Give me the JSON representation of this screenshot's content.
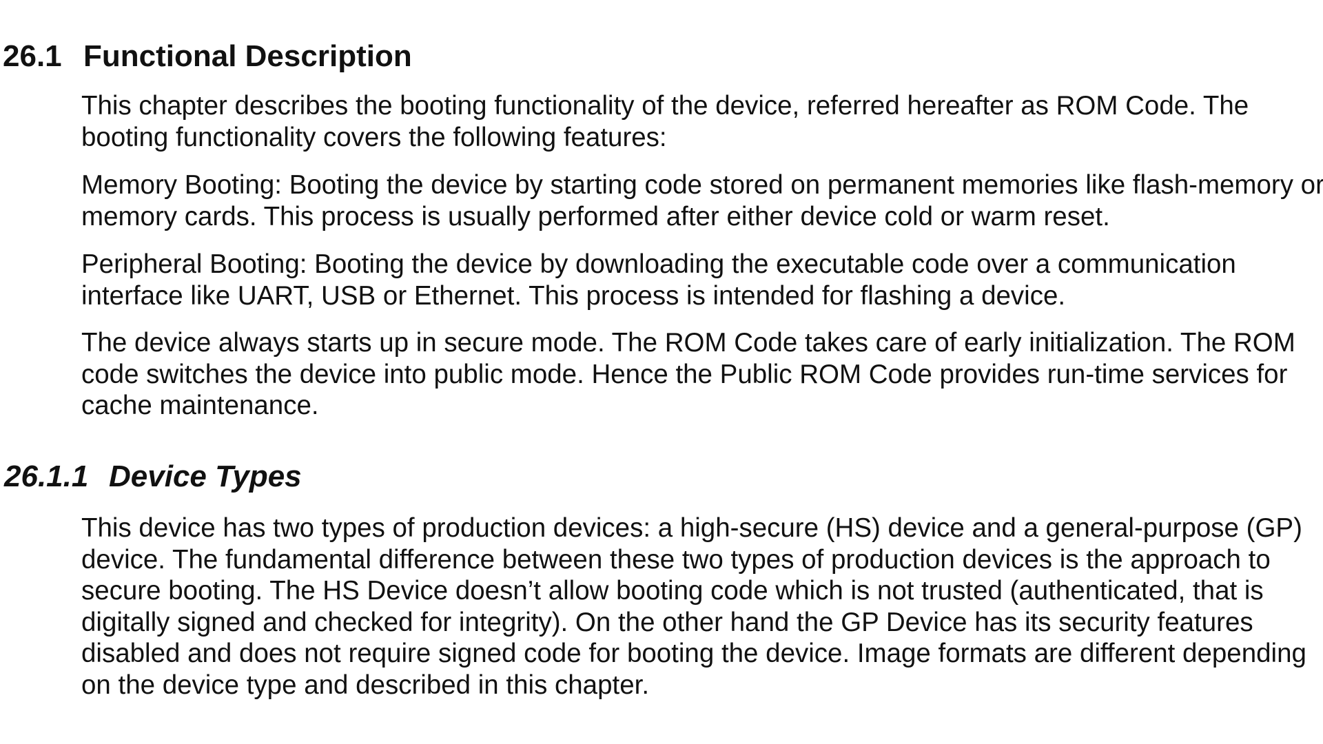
{
  "section": {
    "number": "26.1",
    "title": "Functional Description",
    "paragraphs": [
      {
        "lines": [
          "This chapter describes the booting functionality of the device, referred hereafter as ROM Code. The",
          "booting functionality covers the following features:"
        ]
      },
      {
        "lines": [
          "Memory Booting: Booting the device by starting code stored on permanent memories like flash-memory or",
          "memory cards. This process is usually performed after either device cold or warm reset."
        ]
      },
      {
        "lines": [
          "Peripheral Booting: Booting the device by downloading the executable code over a communication",
          "interface like UART, USB or Ethernet. This process is intended for flashing a device."
        ]
      },
      {
        "lines": [
          "The device always starts up in secure mode. The ROM Code takes care of early initialization. The ROM",
          "code switches the device into public mode. Hence the Public ROM Code provides run-time services for",
          "cache maintenance."
        ]
      }
    ]
  },
  "subsection": {
    "number": "26.1.1",
    "title": "Device Types",
    "paragraphs": [
      {
        "lines": [
          "This device has two types of production devices: a high-secure (HS) device and a general-purpose (GP)",
          "device. The fundamental difference between these two types of production devices is the approach to",
          "secure booting. The HS Device doesn’t allow booting code which is not trusted (authenticated, that is",
          "digitally signed and checked for integrity). On the other hand the GP Device has its security features",
          "disabled and does not require signed code for booting the device. Image formats are different depending",
          "on the device type and described in this chapter."
        ]
      }
    ]
  }
}
